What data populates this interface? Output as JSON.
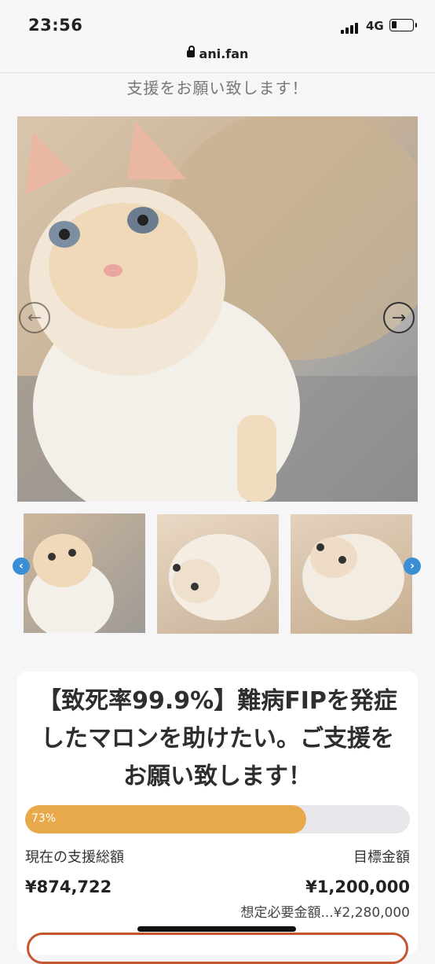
{
  "status_bar": {
    "time": "23:56",
    "network": "4G"
  },
  "browser": {
    "url": "ani.fan"
  },
  "page": {
    "subtitle": "支援をお願い致します！"
  },
  "carousel": {
    "prev_icon": "arrow-left-icon",
    "next_icon": "arrow-right-icon"
  },
  "thumbnails": {
    "prev_icon": "chevron-left-icon",
    "next_icon": "chevron-right-icon"
  },
  "campaign": {
    "title_lines": [
      "【致死率99.9%】難病FIPを発症",
      "したマロンを助けたい。ご支援を",
      "お願い致します！"
    ],
    "progress": {
      "percent_label": "73%",
      "value": 0.73,
      "color": "#e8a94a"
    },
    "current_label": "現在の支援総額",
    "current_amount": "¥874,722",
    "goal_label": "目標金額",
    "goal_amount": "¥1,200,000",
    "required_amount": "想定必要金額...¥2,280,000"
  },
  "colors": {
    "accent": "#e8a94a",
    "nav_blue": "#3a8fd6",
    "cta_border": "#c4562e"
  }
}
